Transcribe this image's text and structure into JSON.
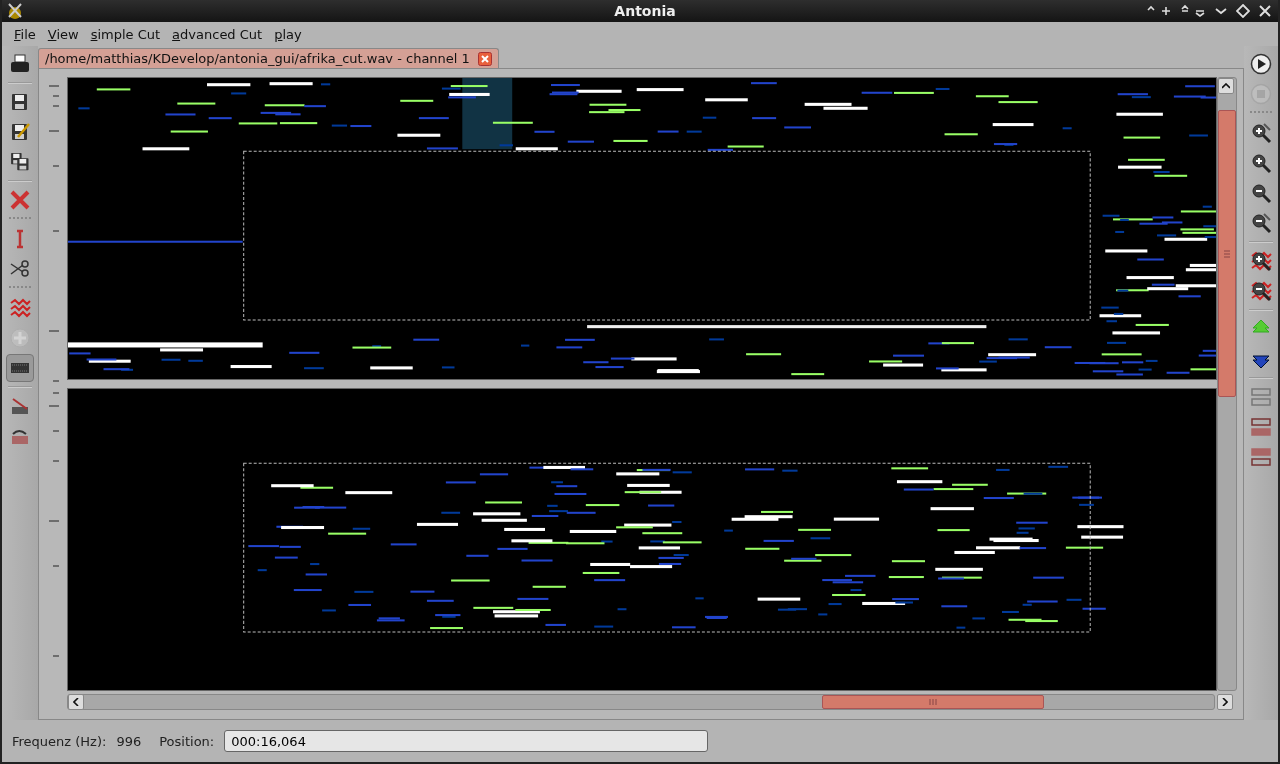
{
  "window": {
    "title": "Antonia"
  },
  "menu": [
    "File",
    "View",
    "simple Cut",
    "advanced Cut",
    "play"
  ],
  "tab": {
    "label": "/home/matthias/KDevelop/antonia_gui/afrika_cut.wav - channel 1",
    "selected": true
  },
  "left_toolbar": [
    {
      "kind": "print",
      "pressed": false,
      "disabled": false
    },
    {
      "kind": "separator"
    },
    {
      "kind": "save",
      "pressed": false,
      "disabled": false
    },
    {
      "kind": "save-as",
      "pressed": false,
      "disabled": false
    },
    {
      "kind": "save-all",
      "pressed": false,
      "disabled": false
    },
    {
      "kind": "separator"
    },
    {
      "kind": "delete",
      "pressed": false,
      "disabled": false
    },
    {
      "kind": "grip"
    },
    {
      "kind": "cursor",
      "pressed": false,
      "disabled": false
    },
    {
      "kind": "scissors",
      "pressed": false,
      "disabled": false
    },
    {
      "kind": "grip"
    },
    {
      "kind": "wave",
      "pressed": false,
      "disabled": false
    },
    {
      "kind": "add",
      "pressed": false,
      "disabled": true
    },
    {
      "kind": "strip",
      "pressed": true,
      "disabled": false
    },
    {
      "kind": "separator"
    },
    {
      "kind": "strip-cut",
      "pressed": false,
      "disabled": false
    },
    {
      "kind": "strip-paste",
      "pressed": false,
      "disabled": false
    }
  ],
  "right_toolbar": [
    {
      "kind": "play",
      "disabled": false
    },
    {
      "kind": "stop",
      "disabled": true
    },
    {
      "kind": "grip"
    },
    {
      "kind": "zoom-fit-in",
      "disabled": false
    },
    {
      "kind": "zoom-in",
      "disabled": false
    },
    {
      "kind": "zoom-out",
      "disabled": false
    },
    {
      "kind": "zoom-fit-out",
      "disabled": false
    },
    {
      "kind": "separator"
    },
    {
      "kind": "wave-zoom-in",
      "disabled": false
    },
    {
      "kind": "wave-zoom-out",
      "disabled": false
    },
    {
      "kind": "separator"
    },
    {
      "kind": "up",
      "disabled": false
    },
    {
      "kind": "down",
      "disabled": false
    },
    {
      "kind": "separator"
    },
    {
      "kind": "split-empty",
      "disabled": false
    },
    {
      "kind": "split-top",
      "disabled": false
    },
    {
      "kind": "split-bottom",
      "disabled": false
    }
  ],
  "status": {
    "frequency_label": "Frequenz (Hz):",
    "frequency_value": "996",
    "position_label": "Position:",
    "position_value": "000:16,064"
  }
}
